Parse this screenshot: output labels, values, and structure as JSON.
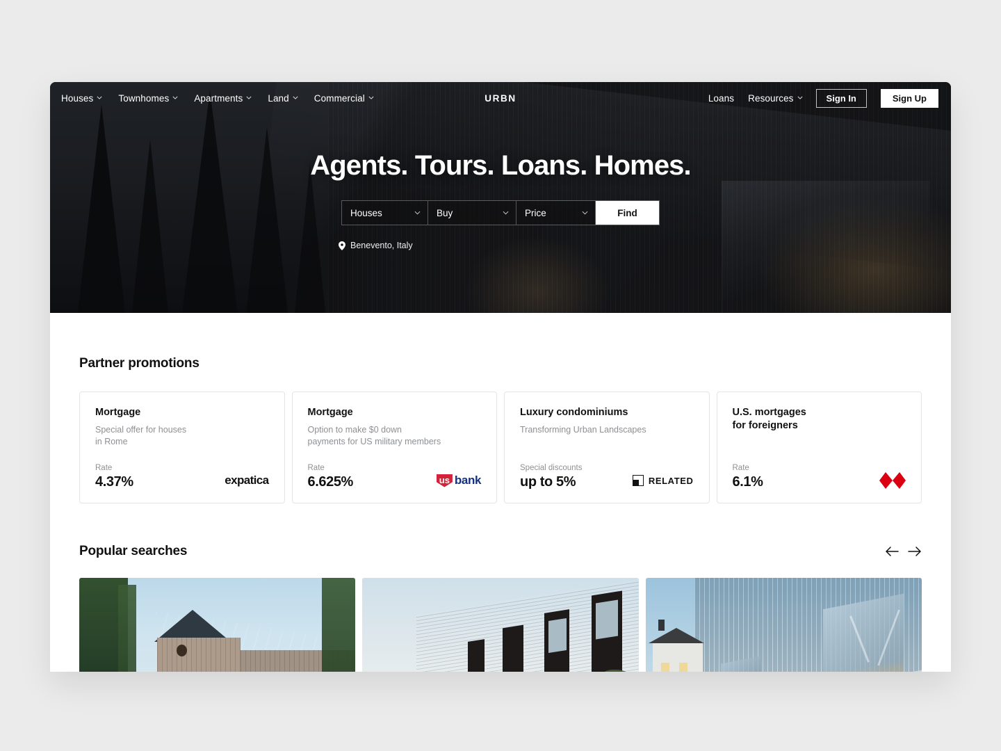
{
  "nav": {
    "items": [
      {
        "label": "Houses",
        "has_dropdown": true
      },
      {
        "label": "Townhomes",
        "has_dropdown": true
      },
      {
        "label": "Apartments",
        "has_dropdown": true
      },
      {
        "label": "Land",
        "has_dropdown": true
      },
      {
        "label": "Commercial",
        "has_dropdown": true
      }
    ],
    "logo": "URBN",
    "right_items": [
      {
        "label": "Loans",
        "has_dropdown": false
      },
      {
        "label": "Resources",
        "has_dropdown": true
      }
    ],
    "sign_in": "Sign In",
    "sign_up": "Sign Up"
  },
  "hero": {
    "title": "Agents. Tours. Loans. Homes.",
    "search": {
      "property_type": "Houses",
      "transaction": "Buy",
      "price": "Price",
      "find_button": "Find"
    },
    "location": "Benevento, Italy"
  },
  "promotions": {
    "heading": "Partner promotions",
    "cards": [
      {
        "title": "Mortgage",
        "subtitle": "Special offer for houses\nin Rome",
        "metric_label": "Rate",
        "metric_value": "4.37%",
        "logo": "expatica-logo",
        "logo_text": "expatica"
      },
      {
        "title": "Mortgage",
        "subtitle": "Option to make $0 down\npayments for US military members",
        "metric_label": "Rate",
        "metric_value": "6.625%",
        "logo": "us-bank-logo",
        "logo_text_1": "us",
        "logo_text_2": "bank"
      },
      {
        "title": "Luxury condominiums",
        "subtitle": "Transforming Urban Landscapes",
        "metric_label": "Special discounts",
        "metric_value": "up to 5%",
        "logo": "related-logo",
        "logo_text": "RELATED"
      },
      {
        "title": "U.S. mortgages\nfor foreigners",
        "subtitle": "",
        "metric_label": "Rate",
        "metric_value": "6.1%",
        "logo": "hsbc-logo"
      }
    ]
  },
  "popular": {
    "heading": "Popular searches",
    "prev_arrow": "←",
    "next_arrow": "→",
    "cards": [
      {
        "name": "barn-style-house-photo"
      },
      {
        "name": "brick-townhouses-photo"
      },
      {
        "name": "modern-glass-building-photo"
      }
    ]
  },
  "colors": {
    "accent_dark": "#1c1d20",
    "page_background": "#ebebeb",
    "card_border": "#e3e4e5",
    "muted_text": "#8d9094",
    "usbank_red": "#d1243b",
    "usbank_navy": "#14317f",
    "hsbc_red": "#db0011"
  }
}
